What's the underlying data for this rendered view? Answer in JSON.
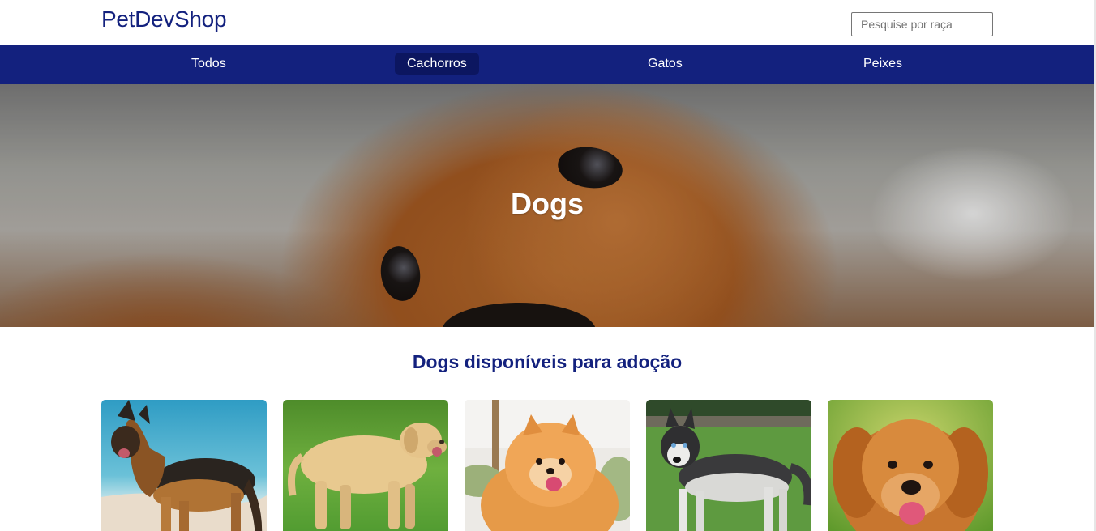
{
  "header": {
    "logo": "PetDevShop",
    "search_placeholder": "Pesquise por raça"
  },
  "nav": {
    "items": [
      {
        "label": "Todos",
        "active": false
      },
      {
        "label": "Cachorros",
        "active": true
      },
      {
        "label": "Gatos",
        "active": false
      },
      {
        "label": "Peixes",
        "active": false
      }
    ]
  },
  "hero": {
    "title": "Dogs"
  },
  "section": {
    "title": "Dogs disponíveis para adoção"
  },
  "cards": [
    {
      "image": "german-shepherd-photo"
    },
    {
      "image": "labrador-photo"
    },
    {
      "image": "pomeranian-photo"
    },
    {
      "image": "husky-photo"
    },
    {
      "image": "golden-retriever-photo"
    }
  ],
  "colors": {
    "brand": "#13217e",
    "nav_active": "#0c1660"
  }
}
